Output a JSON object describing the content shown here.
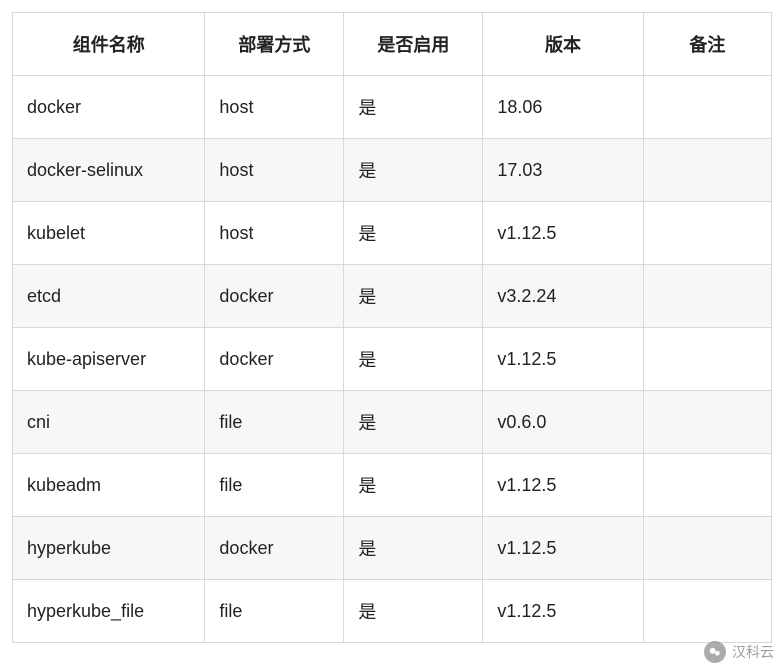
{
  "table": {
    "headers": {
      "name": "组件名称",
      "deploy": "部署方式",
      "enabled": "是否启用",
      "version": "版本",
      "remark": "备注"
    },
    "rows": [
      {
        "name": "docker",
        "deploy": "host",
        "enabled": "是",
        "version": "18.06",
        "remark": ""
      },
      {
        "name": "docker-selinux",
        "deploy": "host",
        "enabled": "是",
        "version": "17.03",
        "remark": ""
      },
      {
        "name": "kubelet",
        "deploy": "host",
        "enabled": "是",
        "version": "v1.12.5",
        "remark": ""
      },
      {
        "name": "etcd",
        "deploy": "docker",
        "enabled": "是",
        "version": "v3.2.24",
        "remark": ""
      },
      {
        "name": "kube-apiserver",
        "deploy": "docker",
        "enabled": "是",
        "version": "v1.12.5",
        "remark": ""
      },
      {
        "name": "cni",
        "deploy": "file",
        "enabled": "是",
        "version": "v0.6.0",
        "remark": ""
      },
      {
        "name": "kubeadm",
        "deploy": "file",
        "enabled": "是",
        "version": "v1.12.5",
        "remark": ""
      },
      {
        "name": "hyperkube",
        "deploy": "docker",
        "enabled": "是",
        "version": "v1.12.5",
        "remark": ""
      },
      {
        "name": "hyperkube_file",
        "deploy": "file",
        "enabled": "是",
        "version": "v1.12.5",
        "remark": ""
      }
    ]
  },
  "watermark": {
    "text": "汉科云"
  }
}
